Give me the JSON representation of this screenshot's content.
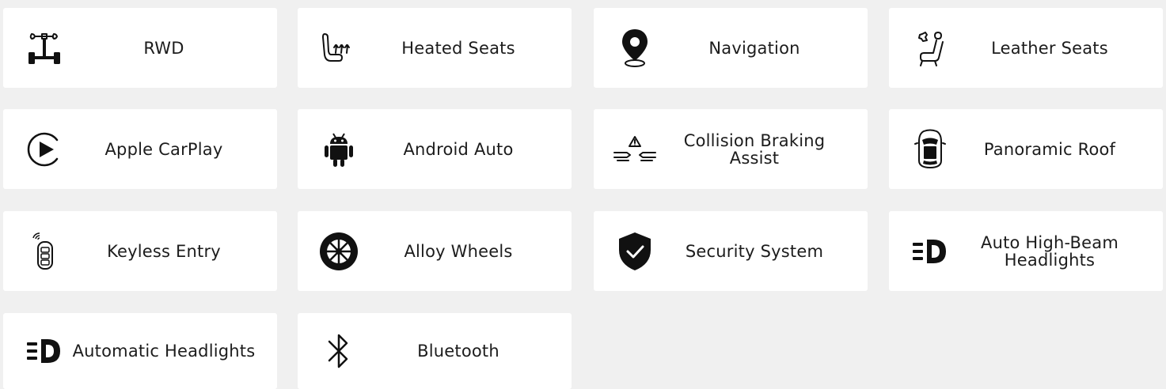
{
  "features": [
    {
      "label": "RWD",
      "icon": "drivetrain-icon"
    },
    {
      "label": "Heated Seats",
      "icon": "heated-seat-icon"
    },
    {
      "label": "Navigation",
      "icon": "map-pin-icon"
    },
    {
      "label": "Leather Seats",
      "icon": "leather-seat-icon"
    },
    {
      "label": "Apple CarPlay",
      "icon": "play-circle-icon"
    },
    {
      "label": "Android Auto",
      "icon": "android-icon"
    },
    {
      "label": "Collision Braking Assist",
      "icon": "collision-warning-icon"
    },
    {
      "label": "Panoramic Roof",
      "icon": "car-roof-icon"
    },
    {
      "label": "Keyless Entry",
      "icon": "key-fob-icon"
    },
    {
      "label": "Alloy Wheels",
      "icon": "wheel-icon"
    },
    {
      "label": "Security System",
      "icon": "shield-check-icon"
    },
    {
      "label": "Auto High-Beam Headlights",
      "icon": "headlight-icon"
    },
    {
      "label": "Automatic Headlights",
      "icon": "headlight-icon"
    },
    {
      "label": "Bluetooth",
      "icon": "bluetooth-icon"
    }
  ]
}
